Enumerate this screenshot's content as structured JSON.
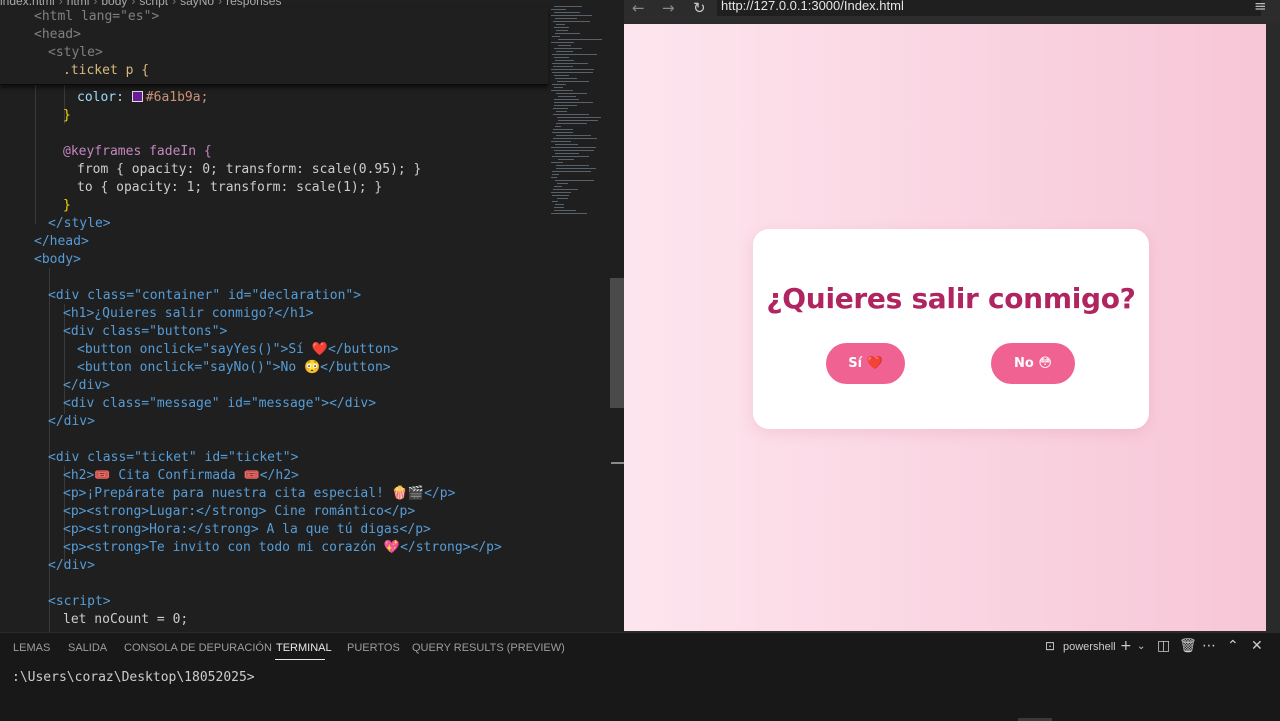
{
  "editor": {
    "breadcrumb": [
      "index.html",
      "html",
      "body",
      "script",
      "sayNo",
      "responses"
    ],
    "sticky_lines": [
      "<html lang=\"es\">",
      "<head>",
      "<style>",
      ".ticket p {"
    ],
    "code": {
      "l1": "color:",
      "l1v": "#6a1b9a;",
      "l2": "}",
      "l3": "@keyframes fadeIn {",
      "l4": "from { opacity: 0; transform: scale(0.95); }",
      "l5": "to { opacity: 1; transform: scale(1); }",
      "l6": "}",
      "l7": "</style>",
      "l8": "</head>",
      "l9": "<body>",
      "l11": "<div class=\"container\" id=\"declaration\">",
      "l12": "<h1>¿Quieres salir conmigo?</h1>",
      "l13": "<div class=\"buttons\">",
      "l14": "<button onclick=\"sayYes()\">Sí ❤️</button>",
      "l15": "<button onclick=\"sayNo()\">No 😳</button>",
      "l16": "</div>",
      "l17": "<div class=\"message\" id=\"message\"></div>",
      "l18": "</div>",
      "l20": "<div class=\"ticket\" id=\"ticket\">",
      "l21": "<h2>🎟️ Cita Confirmada 🎟️</h2>",
      "l22": "<p>¡Prepárate para nuestra cita especial! 🍿🎬</p>",
      "l23": "<p><strong>Lugar:</strong> Cine romántico</p>",
      "l24": "<p><strong>Hora:</strong> A la que tú digas</p>",
      "l25": "<p><strong>Te invito con todo mi corazón 💖</strong></p>",
      "l26": "</div>",
      "l28": "<script>",
      "l29": "let noCount = 0;"
    }
  },
  "browser": {
    "url": "http://127.0.0.1:3000/Index.html",
    "card": {
      "title": "¿Quieres salir conmigo?",
      "yes_label": "Sí ❤️",
      "no_label": "No 😳"
    },
    "colors": {
      "title": "#b0245f",
      "button": "#f06292",
      "bg_start": "#fde5ee",
      "bg_end": "#f7c6d7"
    }
  },
  "panel": {
    "tabs": [
      "LEMAS",
      "SALIDA",
      "CONSOLA DE DEPURACIÓN",
      "TERMINAL",
      "PUERTOS",
      "QUERY RESULTS (PREVIEW)"
    ],
    "active_tab": "TERMINAL",
    "shell": "powershell",
    "prompt": ":\\Users\\coraz\\Desktop\\18052025>"
  }
}
